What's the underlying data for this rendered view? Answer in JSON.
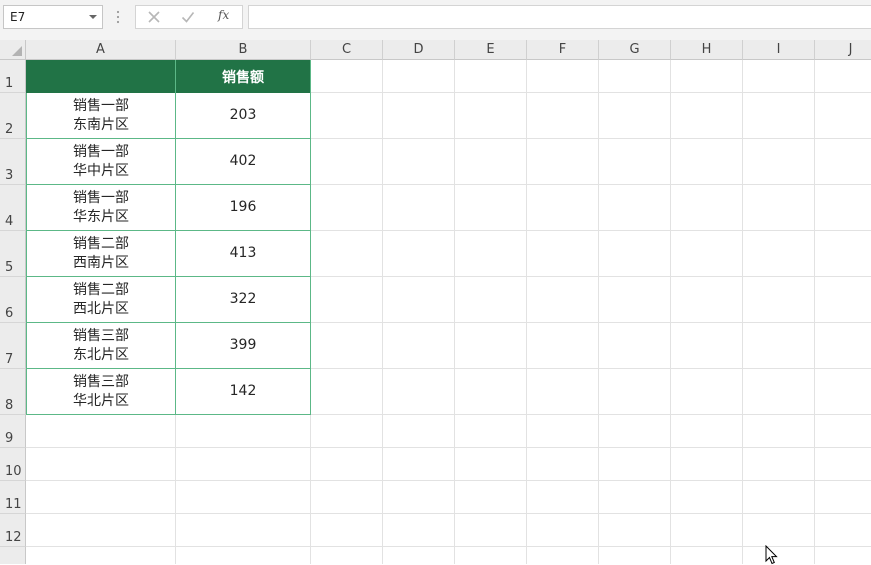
{
  "formula_bar": {
    "name_box": "E7",
    "formula": "",
    "cancel_icon": "x-icon",
    "enter_icon": "checkmark-icon",
    "function_label": "fx"
  },
  "columns": [
    "A",
    "B",
    "C",
    "D",
    "E",
    "F",
    "G",
    "H",
    "I",
    "J"
  ],
  "rows": [
    "1",
    "2",
    "3",
    "4",
    "5",
    "6",
    "7",
    "8",
    "9",
    "10",
    "11",
    "12"
  ],
  "table": {
    "header": {
      "a": "",
      "b": "销售额"
    },
    "rows": [
      {
        "dept": "销售一部",
        "region": "东南片区",
        "sales": "203"
      },
      {
        "dept": "销售一部",
        "region": "华中片区",
        "sales": "402"
      },
      {
        "dept": "销售一部",
        "region": "华东片区",
        "sales": "196"
      },
      {
        "dept": "销售二部",
        "region": "西南片区",
        "sales": "413"
      },
      {
        "dept": "销售二部",
        "region": "西北片区",
        "sales": "322"
      },
      {
        "dept": "销售三部",
        "region": "东北片区",
        "sales": "399"
      },
      {
        "dept": "销售三部",
        "region": "华北片区",
        "sales": "142"
      }
    ]
  },
  "colors": {
    "header_fill": "#217346",
    "table_border": "#5cb887"
  }
}
